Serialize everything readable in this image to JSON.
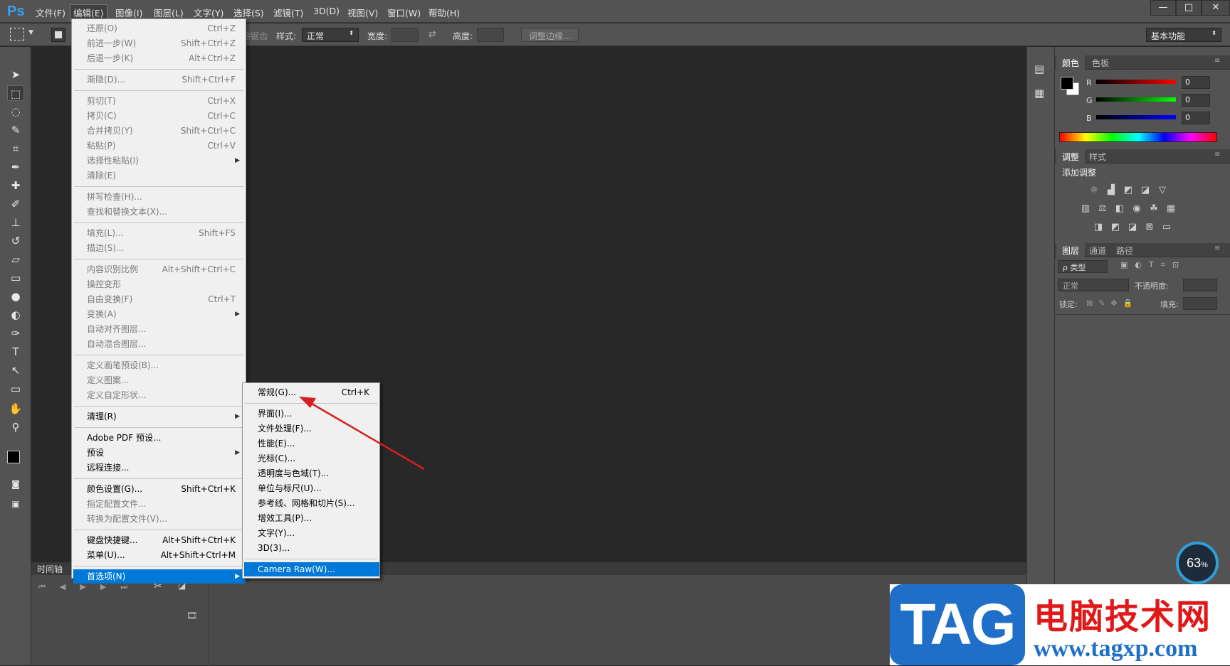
{
  "app": {
    "logo": "Ps"
  },
  "menubar": {
    "items": [
      "文件(F)",
      "编辑(E)",
      "图像(I)",
      "图层(L)",
      "文字(Y)",
      "选择(S)",
      "滤镜(T)",
      "3D(D)",
      "视图(V)",
      "窗口(W)",
      "帮助(H)"
    ],
    "active": "编辑(E)"
  },
  "window_controls": {
    "minimize": "—",
    "maximize": "□",
    "close": "✕"
  },
  "options_bar": {
    "clipped_text": "消除锯齿",
    "style_label": "样式:",
    "style_value": "正常",
    "width_label": "宽度:",
    "height_label": "高度:",
    "refine_edge": "调整边缘...",
    "workspace": "基本功能"
  },
  "edit_menu": {
    "items": [
      {
        "label": "还原(O)",
        "shortcut": "Ctrl+Z",
        "enabled": false
      },
      {
        "label": "前进一步(W)",
        "shortcut": "Shift+Ctrl+Z",
        "enabled": false
      },
      {
        "label": "后退一步(K)",
        "shortcut": "Alt+Ctrl+Z",
        "enabled": false
      },
      {
        "label": "渐隐(D)...",
        "shortcut": "Shift+Ctrl+F",
        "enabled": false
      },
      {
        "label": "剪切(T)",
        "shortcut": "Ctrl+X",
        "enabled": false
      },
      {
        "label": "拷贝(C)",
        "shortcut": "Ctrl+C",
        "enabled": false
      },
      {
        "label": "合并拷贝(Y)",
        "shortcut": "Shift+Ctrl+C",
        "enabled": false
      },
      {
        "label": "粘贴(P)",
        "shortcut": "Ctrl+V",
        "enabled": false
      },
      {
        "label": "选择性粘贴(I)",
        "shortcut": "",
        "enabled": false,
        "submenu": true
      },
      {
        "label": "清除(E)",
        "shortcut": "",
        "enabled": false
      },
      {
        "label": "拼写检查(H)...",
        "shortcut": "",
        "enabled": false
      },
      {
        "label": "查找和替换文本(X)...",
        "shortcut": "",
        "enabled": false
      },
      {
        "label": "填充(L)...",
        "shortcut": "Shift+F5",
        "enabled": false
      },
      {
        "label": "描边(S)...",
        "shortcut": "",
        "enabled": false
      },
      {
        "label": "内容识别比例",
        "shortcut": "Alt+Shift+Ctrl+C",
        "enabled": false
      },
      {
        "label": "操控变形",
        "shortcut": "",
        "enabled": false
      },
      {
        "label": "自由变换(F)",
        "shortcut": "Ctrl+T",
        "enabled": false
      },
      {
        "label": "变换(A)",
        "shortcut": "",
        "enabled": false,
        "submenu": true
      },
      {
        "label": "自动对齐图层...",
        "shortcut": "",
        "enabled": false
      },
      {
        "label": "自动混合图层...",
        "shortcut": "",
        "enabled": false
      },
      {
        "label": "定义画笔预设(B)...",
        "shortcut": "",
        "enabled": false
      },
      {
        "label": "定义图案...",
        "shortcut": "",
        "enabled": false
      },
      {
        "label": "定义自定形状...",
        "shortcut": "",
        "enabled": false
      },
      {
        "label": "清理(R)",
        "shortcut": "",
        "enabled": true,
        "submenu": true
      },
      {
        "label": "Adobe PDF 预设...",
        "shortcut": "",
        "enabled": true
      },
      {
        "label": "预设",
        "shortcut": "",
        "enabled": true,
        "submenu": true
      },
      {
        "label": "远程连接...",
        "shortcut": "",
        "enabled": true
      },
      {
        "label": "颜色设置(G)...",
        "shortcut": "Shift+Ctrl+K",
        "enabled": true
      },
      {
        "label": "指定配置文件...",
        "shortcut": "",
        "enabled": false
      },
      {
        "label": "转换为配置文件(V)...",
        "shortcut": "",
        "enabled": false
      },
      {
        "label": "键盘快捷键...",
        "shortcut": "Alt+Shift+Ctrl+K",
        "enabled": true
      },
      {
        "label": "菜单(U)...",
        "shortcut": "Alt+Shift+Ctrl+M",
        "enabled": true
      },
      {
        "label": "首选项(N)",
        "shortcut": "",
        "enabled": true,
        "submenu": true,
        "highlighted": true
      }
    ]
  },
  "prefs_submenu": {
    "items": [
      {
        "label": "常规(G)...",
        "shortcut": "Ctrl+K"
      },
      {
        "label": "界面(I)...",
        "shortcut": ""
      },
      {
        "label": "文件处理(F)...",
        "shortcut": ""
      },
      {
        "label": "性能(E)...",
        "shortcut": ""
      },
      {
        "label": "光标(C)...",
        "shortcut": ""
      },
      {
        "label": "透明度与色域(T)...",
        "shortcut": ""
      },
      {
        "label": "单位与标尺(U)...",
        "shortcut": ""
      },
      {
        "label": "参考线、网格和切片(S)...",
        "shortcut": ""
      },
      {
        "label": "增效工具(P)...",
        "shortcut": ""
      },
      {
        "label": "文字(Y)...",
        "shortcut": ""
      },
      {
        "label": "3D(3)...",
        "shortcut": ""
      },
      {
        "label": "Camera Raw(W)...",
        "shortcut": "",
        "highlighted": true
      }
    ]
  },
  "timeline": {
    "title": "时间轴"
  },
  "color_panel": {
    "tabs": [
      "颜色",
      "色板"
    ],
    "r_label": "R",
    "g_label": "G",
    "b_label": "B",
    "r_value": "0",
    "g_value": "0",
    "b_value": "0"
  },
  "adjust_panel": {
    "tabs": [
      "调整",
      "样式"
    ],
    "title": "添加调整"
  },
  "layers_panel": {
    "tabs": [
      "图层",
      "通道",
      "路径"
    ],
    "filter_label": "ρ 类型",
    "blend_mode": "正常",
    "opacity_label": "不透明度:",
    "lock_label": "锁定:",
    "fill_label": "填充:"
  },
  "zoom_badge": {
    "value": "63",
    "unit": "%"
  },
  "watermark": {
    "tag": "TAG",
    "cn": "电脑技术网",
    "url": "www.tagxp.com"
  },
  "colors": {
    "ui_bg": "#535353",
    "canvas": "#282828",
    "highlight": "#0078d7",
    "arrow": "#d42020"
  }
}
